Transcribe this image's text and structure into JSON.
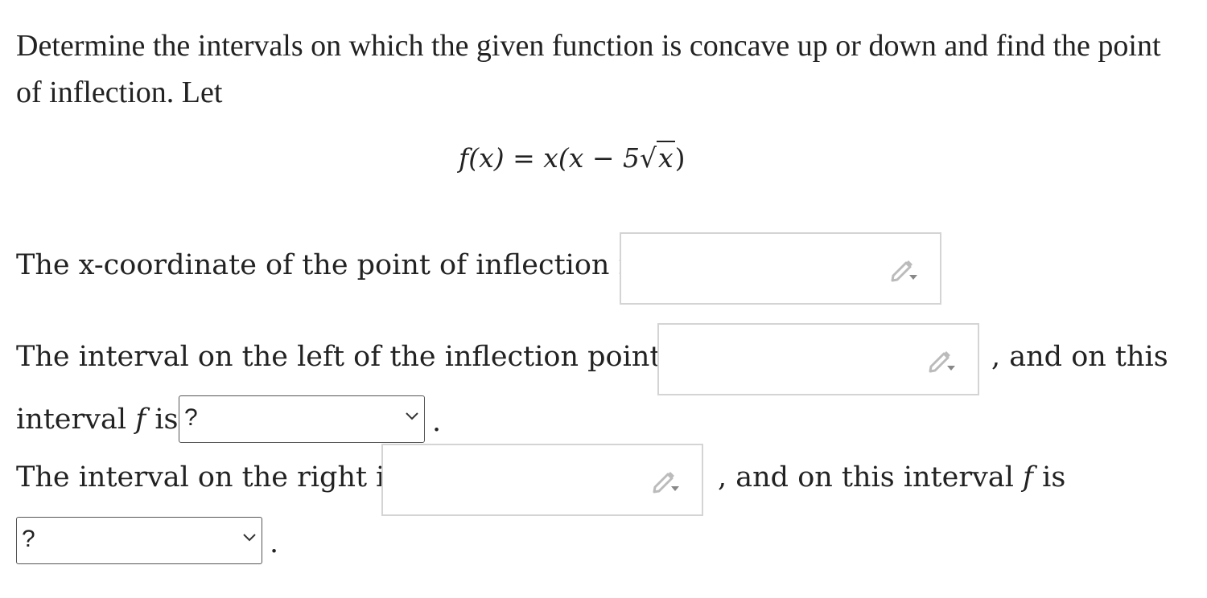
{
  "question": {
    "intro": "Determine the intervals on which the given function is concave up or down and find the point of inflection. Let",
    "formula": {
      "lhs": "f(x)",
      "eq": "=",
      "rhs_start": "x(x − 5",
      "sqrt_arg": "x",
      "rhs_end": ")"
    }
  },
  "inflection": {
    "label": "The x-coordinate of the point of inflection is",
    "input_value": ""
  },
  "left_interval": {
    "label": "The interval on the left of the inflection point is",
    "input_value": "",
    "after": ", and on this",
    "line2_prefix": "interval",
    "func": "f",
    "is": "is",
    "select_value": "?",
    "period": "."
  },
  "right_interval": {
    "label": "The interval on the right is",
    "input_value": "",
    "after": ", and on this interval",
    "func": "f",
    "is": "is",
    "select_value": "?",
    "period": "."
  },
  "icons": {
    "answer_input": "pencil-dropdown-icon",
    "select": "chevron-down-icon"
  },
  "colors": {
    "text": "#222222",
    "input_border": "#d4d4d4",
    "select_border": "#555555",
    "icon": "#bbbbbb"
  }
}
